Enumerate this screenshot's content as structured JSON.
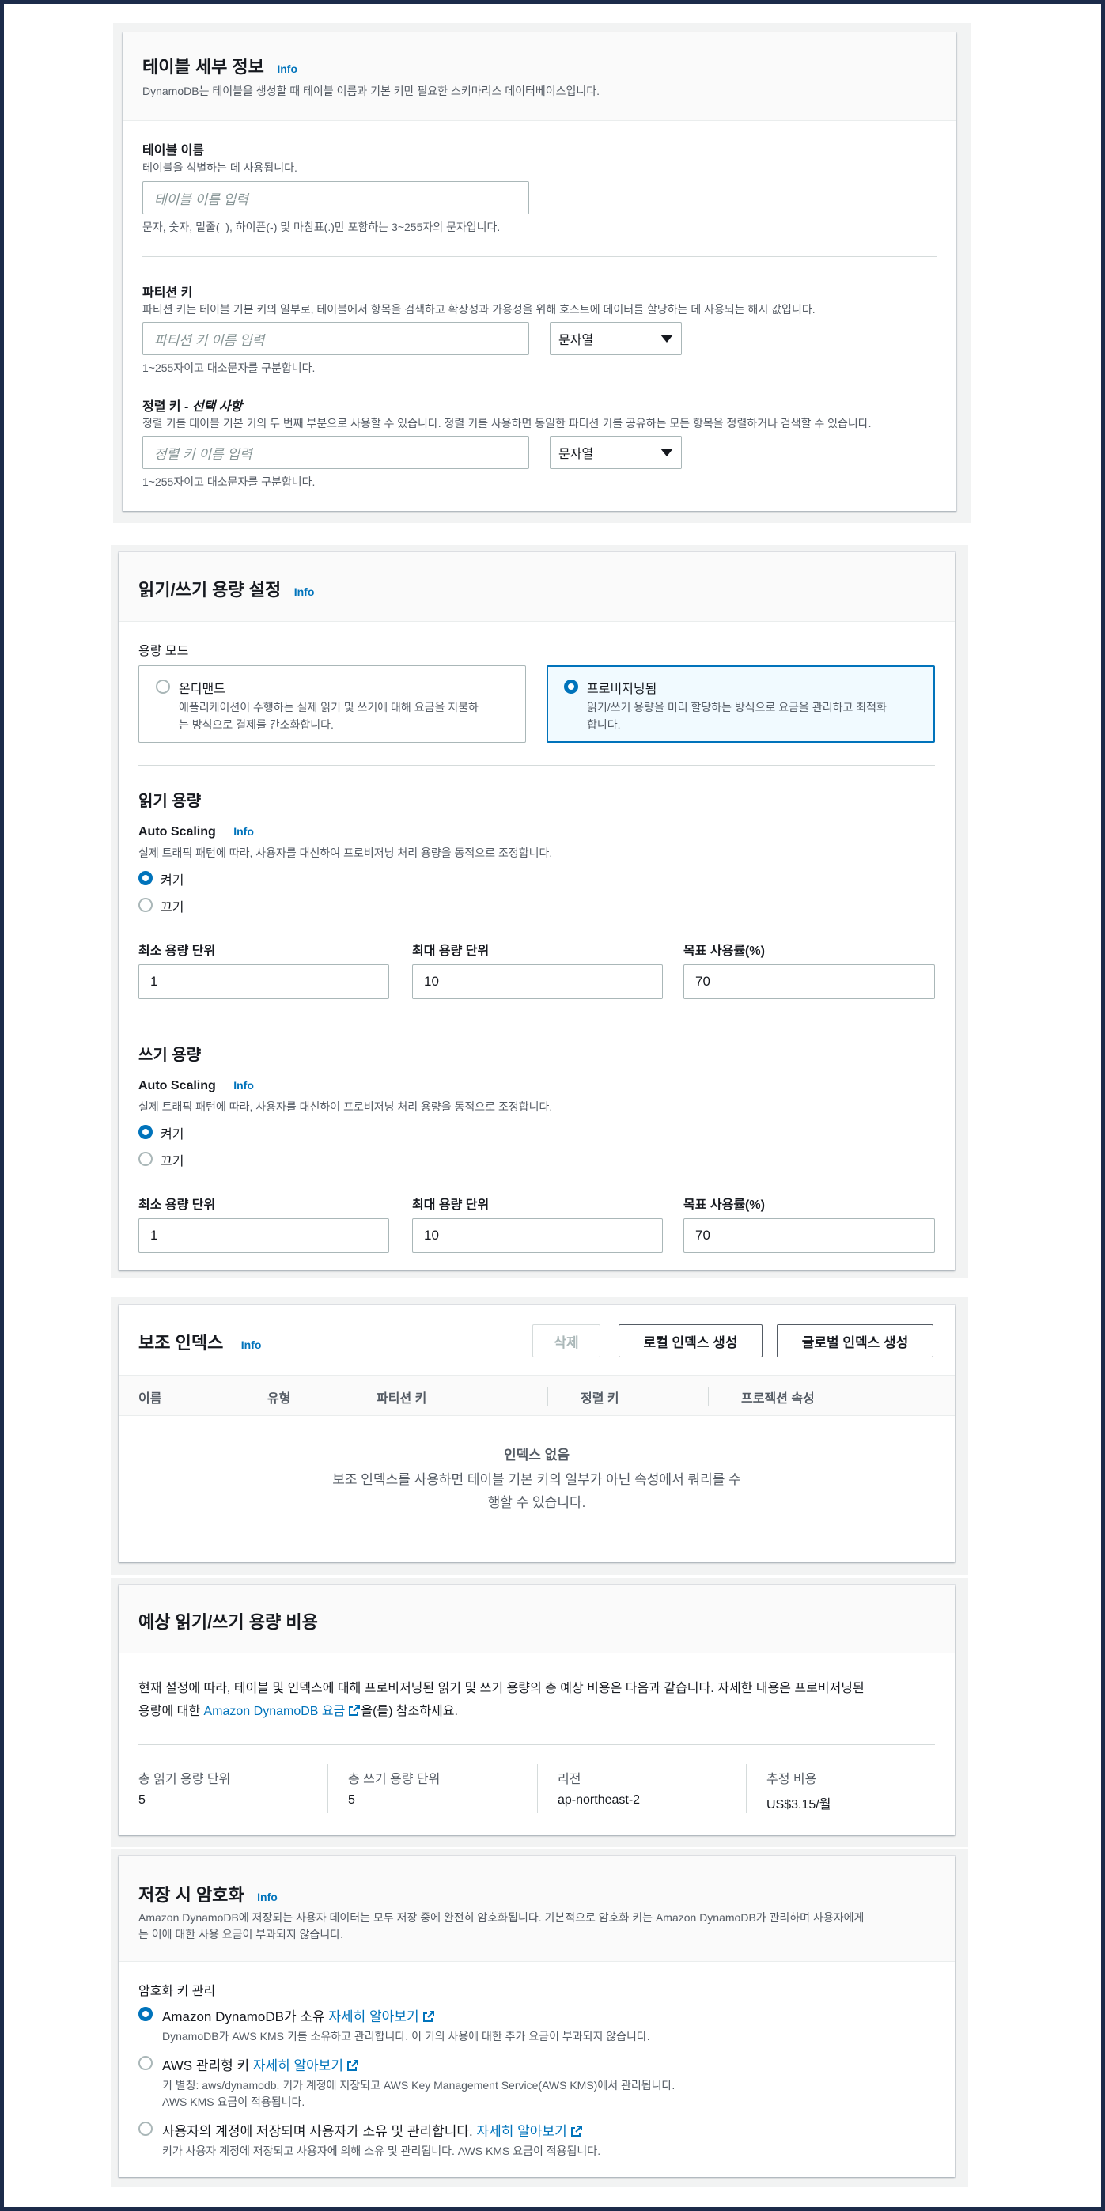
{
  "table_details": {
    "title": "테이블 세부 정보",
    "info": "Info",
    "description": "DynamoDB는 테이블을 생성할 때 테이블 이름과 기본 키만 필요한 스키마리스 데이터베이스입니다.",
    "name": {
      "label": "테이블 이름",
      "description": "테이블을 식별하는 데 사용됩니다.",
      "placeholder": "테이블 이름 입력",
      "hint": "문자, 숫자, 밑줄(_), 하이픈(-) 및 마침표(.)만 포함하는 3~255자의 문자입니다."
    },
    "partition_key": {
      "label": "파티션 키",
      "description": "파티션 키는 테이블 기본 키의 일부로, 테이블에서 항목을 검색하고 확장성과 가용성을 위해 호스트에 데이터를 할당하는 데 사용되는 해시 값입니다.",
      "placeholder": "파티션 키 이름 입력",
      "type": "문자열",
      "hint": "1~255자이고 대소문자를 구분합니다."
    },
    "sort_key": {
      "label": "정렬 키 - ",
      "label_optional": "선택 사항",
      "description": "정렬 키를 테이블 기본 키의 두 번째 부분으로 사용할 수 있습니다. 정렬 키를 사용하면 동일한 파티션 키를 공유하는 모든 항목을 정렬하거나 검색할 수 있습니다.",
      "placeholder": "정렬 키 이름 입력",
      "type": "문자열",
      "hint": "1~255자이고 대소문자를 구분합니다."
    }
  },
  "capacity": {
    "title": "읽기/쓰기 용량 설정",
    "info": "Info",
    "mode_label": "용량 모드",
    "on_demand": {
      "title": "온디맨드",
      "description_line1": "애플리케이션이 수행하는 실제 읽기 및 쓰기에 대해 요금을 지불하",
      "description_line2": "는 방식으로 결제를 간소화합니다."
    },
    "provisioned": {
      "title": "프로비저닝됨",
      "description_line1": "읽기/쓰기 용량을 미리 할당하는 방식으로 요금을 관리하고 최적화",
      "description_line2": "합니다."
    },
    "read": {
      "title": "읽기 용량",
      "autoscaling_label": "Auto Scaling",
      "info": "Info",
      "autoscaling_desc": "실제 트래픽 패턴에 따라, 사용자를 대신하여 프로비저닝 처리 용량을 동적으로 조정합니다.",
      "on_label": "켜기",
      "off_label": "끄기",
      "min_label": "최소 용량 단위",
      "max_label": "최대 용량 단위",
      "target_label": "목표 사용률(%)",
      "min_value": "1",
      "max_value": "10",
      "target_value": "70"
    },
    "write": {
      "title": "쓰기 용량",
      "autoscaling_label": "Auto Scaling",
      "info": "Info",
      "autoscaling_desc": "실제 트래픽 패턴에 따라, 사용자를 대신하여 프로비저닝 처리 용량을 동적으로 조정합니다.",
      "on_label": "켜기",
      "off_label": "끄기",
      "min_label": "최소 용량 단위",
      "max_label": "최대 용량 단위",
      "target_label": "목표 사용률(%)",
      "min_value": "1",
      "max_value": "10",
      "target_value": "70"
    }
  },
  "secondary_indexes": {
    "title": "보조 인덱스",
    "info": "Info",
    "delete_label": "삭제",
    "local_label": "로컬 인덱스 생성",
    "global_label": "글로벌 인덱스 생성",
    "columns": [
      "이름",
      "유형",
      "파티션 키",
      "정렬 키",
      "프로젝션 속성"
    ],
    "empty_title": "인덱스 없음",
    "empty_line1": "보조 인덱스를 사용하면 테이블 기본 키의 일부가 아닌 속성에서 쿼리를 수",
    "empty_line2": "행할 수 있습니다."
  },
  "cost": {
    "title": "예상 읽기/쓰기 용량 비용",
    "text_line1": "현재 설정에 따라, 테이블 및 인덱스에 대해 프로비저닝된 읽기 및 쓰기 용량의 총 예상 비용은 다음과 같습니다. 자세한 내용은 프로비저닝된",
    "text_line2_prefix": "용량에 대한 ",
    "link": "Amazon DynamoDB 요금",
    "text_line2_suffix": "을(를) 참조하세요.",
    "items": [
      {
        "label": "총 읽기 용량 단위",
        "value": "5"
      },
      {
        "label": "총 쓰기 용량 단위",
        "value": "5"
      },
      {
        "label": "리전",
        "value": "ap-northeast-2"
      },
      {
        "label": "추정 비용",
        "value": "US$3.15/월"
      }
    ]
  },
  "encryption": {
    "title": "저장 시 암호화",
    "info": "Info",
    "description_line1": "Amazon DynamoDB에 저장되는 사용자 데이터는 모두 저장 중에 완전히 암호화됩니다. 기본적으로 암호화 키는 Amazon DynamoDB가 관리하며 사용자에게",
    "description_line2": "는 이에 대한 사용 요금이 부과되지 않습니다.",
    "key_label": "암호화 키 관리",
    "learn_more": "자세히 알아보기",
    "options": [
      {
        "title": "Amazon DynamoDB가 소유",
        "desc1": "DynamoDB가 AWS KMS 키를 소유하고 관리합니다. 이 키의 사용에 대한 추가 요금이 부과되지 않습니다."
      },
      {
        "title": "AWS 관리형 키",
        "desc1": "키 별칭: aws/dynamodb. 키가 계정에 저장되고 AWS Key Management Service(AWS KMS)에서 관리됩니다.",
        "desc2": "AWS KMS 요금이 적용됩니다."
      },
      {
        "title": "사용자의 계정에 저장되며 사용자가 소유 및 관리합니다.",
        "desc1": "키가 사용자 계정에 저장되고 사용자에 의해 소유 및 관리됩니다. AWS KMS 요금이 적용됩니다."
      }
    ]
  },
  "colors": {
    "accent": "#0073bb",
    "selected_bg": "#f1faff",
    "frame": "#1c2b4a"
  }
}
